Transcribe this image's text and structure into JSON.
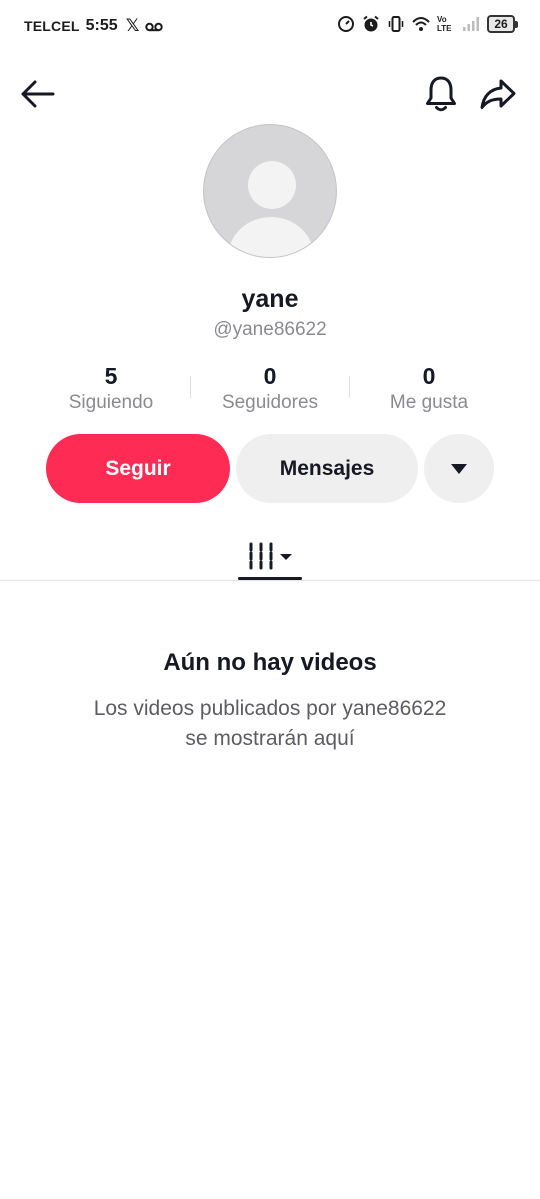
{
  "status_bar": {
    "carrier": "TELCEL",
    "time": "5:55",
    "x_glyph": "𝕏",
    "network_label": "Vo LTE",
    "battery": "26"
  },
  "icons": {
    "back": "back-arrow-icon",
    "bell": "bell-icon",
    "share": "share-arrow-icon",
    "more": "caret-down-icon",
    "grid": "videos-grid-icon"
  },
  "profile": {
    "display_name": "yane",
    "username": "@yane86622"
  },
  "stats": [
    {
      "value": "5",
      "label": "Siguiendo"
    },
    {
      "value": "0",
      "label": "Seguidores"
    },
    {
      "value": "0",
      "label": "Me gusta"
    }
  ],
  "actions": {
    "follow_label": "Seguir",
    "message_label": "Mensajes"
  },
  "empty_state": {
    "title": "Aún no hay videos",
    "description": "Los videos publicados por yane86622 se mostrarán aquí"
  },
  "colors": {
    "accent": "#fe2c55",
    "secondary_button": "#efeff0",
    "muted_text": "#8a8b91"
  }
}
